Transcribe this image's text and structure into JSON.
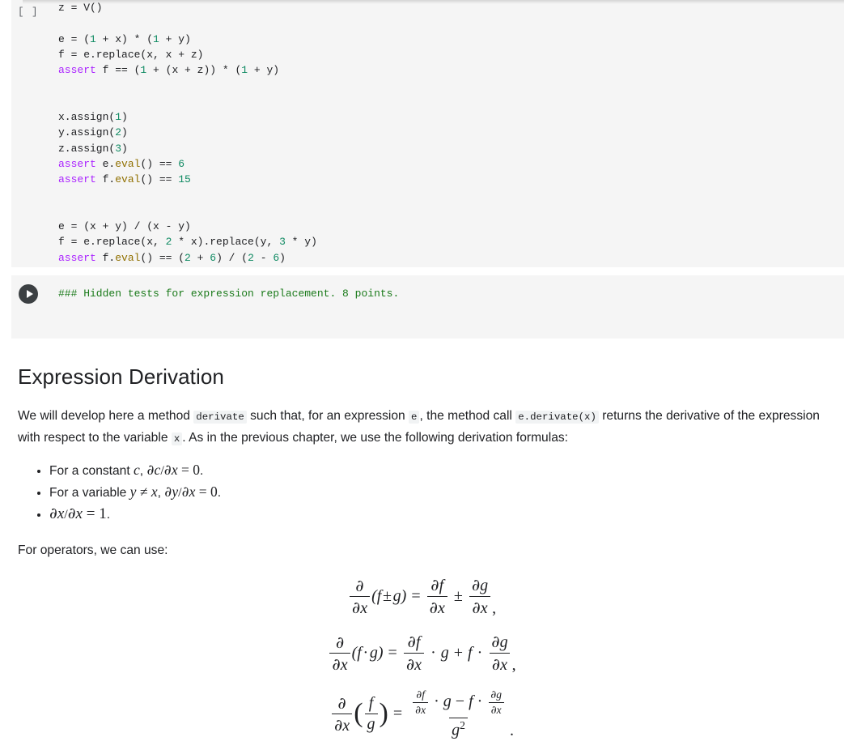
{
  "cells": [
    {
      "type": "code",
      "prompt": "[ ]",
      "partial_top_line": "z = V()",
      "lines": [
        "e = (1 + x) * (1 + y)",
        "f = e.replace(x, x + z)",
        "assert f == (1 + (x + z)) * (1 + y)",
        "",
        "x.assign(1)",
        "y.assign(2)",
        "z.assign(3)",
        "assert e.eval() == 6",
        "assert f.eval() == 15",
        "",
        "e = (x + y) / (x - y)",
        "f = e.replace(x, 2 * x).replace(y, 3 * y)",
        "assert f.eval() == (2 + 6) / (2 - 6)"
      ]
    },
    {
      "type": "code",
      "run_button": "run-cell-button",
      "lines": [
        "### Hidden tests for expression replacement. 8 points."
      ]
    }
  ],
  "code_tokens": {
    "c1_l0": [
      "z",
      " = ",
      "V()"
    ],
    "keyword": "assert",
    "numbers": [
      "1",
      "1",
      "1",
      "1",
      "1",
      "2",
      "3",
      "6",
      "15",
      "2",
      "3",
      "2",
      "6",
      "2",
      "6"
    ],
    "function": "eval",
    "comment_color": "#1a7a1a",
    "keyword_color": "#aa22ff",
    "number_color": "#0f8a62",
    "function_color": "#907000"
  },
  "section": {
    "title": "Expression Derivation",
    "paragraph1": {
      "part1": "We will develop here a method ",
      "code1": "derivate",
      "part2": " such that, for an expression ",
      "code2": "e",
      "part3": ", the method call ",
      "code3": "e.derivate(x)",
      "part4": " returns the derivative of the expression with respect to the variable ",
      "code4": "x",
      "part5": ". As in the previous chapter, we use the following derivation formulas:"
    },
    "rules": [
      {
        "prefix": "For a constant ",
        "var": "c",
        "comma": ", ",
        "formula": "∂c/∂x = 0",
        "suffix": "."
      },
      {
        "prefix": "For a variable ",
        "var": "y ≠ x",
        "comma": ", ",
        "formula": "∂y/∂x = 0",
        "suffix": "."
      },
      {
        "prefix": "",
        "var": "",
        "comma": "",
        "formula": "∂x/∂x = 1",
        "suffix": "."
      }
    ],
    "paragraph2": "For operators, we can use:",
    "formulas": [
      {
        "id": "sum-rule",
        "latex": "\\frac{\\partial}{\\partial x}(f \\pm g) = \\frac{\\partial f}{\\partial x} \\pm \\frac{\\partial g}{\\partial x},",
        "numerator_left": "∂",
        "denominator_left": "∂x",
        "body": "(f ± g)",
        "equals": "=",
        "rhs_op": "±",
        "trailing": ","
      },
      {
        "id": "product-rule",
        "latex": "\\frac{\\partial}{\\partial x}(f \\cdot g) = \\frac{\\partial f}{\\partial x} \\cdot g + f \\cdot \\frac{\\partial g}{\\partial x},",
        "numerator_left": "∂",
        "denominator_left": "∂x",
        "body": "(f · g)",
        "equals": "=",
        "rhs_op": "+",
        "trailing": ","
      },
      {
        "id": "quotient-rule",
        "latex": "\\frac{\\partial}{\\partial x}\\left(\\frac{f}{g}\\right) = \\frac{\\frac{\\partial f}{\\partial x} \\cdot g - f \\cdot \\frac{\\partial g}{\\partial x}}{g^2}.",
        "numerator_left": "∂",
        "denominator_left": "∂x",
        "equals": "=",
        "denominator_right": "g²",
        "trailing": "."
      }
    ],
    "math_symbols": {
      "partial": "∂",
      "plusminus": "±",
      "cdot": "·",
      "neq": "≠",
      "f": "f",
      "g": "g",
      "x": "x",
      "zero": "0",
      "one": "1"
    }
  }
}
